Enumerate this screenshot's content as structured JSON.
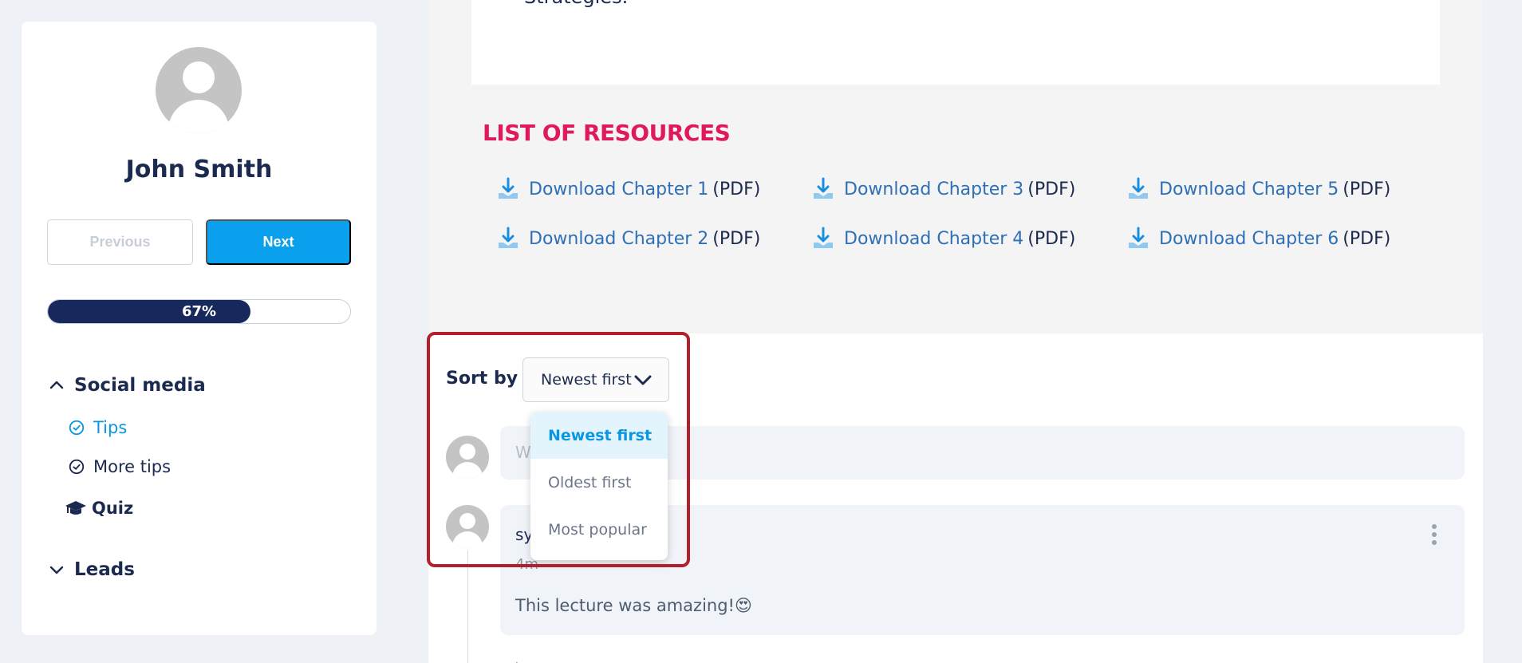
{
  "sidebar": {
    "user_name": "John Smith",
    "prev_label": "Previous",
    "next_label": "Next",
    "progress": {
      "percent": 67,
      "label": "67%"
    },
    "sections": [
      {
        "label": "Social media",
        "expanded": true
      },
      {
        "label": "Leads",
        "expanded": false
      }
    ],
    "items": [
      {
        "label": "Tips",
        "active": true,
        "icon": "check-circle-icon"
      },
      {
        "label": "More tips",
        "active": false,
        "icon": "check-circle-icon"
      }
    ],
    "quiz_label": "Quiz"
  },
  "top_card": {
    "text": "Strategies."
  },
  "resources": {
    "title": "LIST OF RESOURCES",
    "suffix": "(PDF)",
    "links": [
      "Download Chapter 1",
      "Download Chapter 2",
      "Download Chapter 3",
      "Download Chapter 4",
      "Download Chapter 5",
      "Download Chapter 6"
    ]
  },
  "comments": {
    "sort_label": "Sort by",
    "sort_value": "Newest first",
    "sort_options": [
      "Newest first",
      "Oldest first",
      "Most popular"
    ],
    "input_placeholder": "W",
    "comment": {
      "author": "sy",
      "time": "4m",
      "text": "This lecture was amazing!😍"
    },
    "thread_bit": "·"
  },
  "colors": {
    "primary": "#0ba0ee",
    "navy": "#17295c",
    "accent": "#e0195d",
    "highlight": "#b31f2b"
  }
}
